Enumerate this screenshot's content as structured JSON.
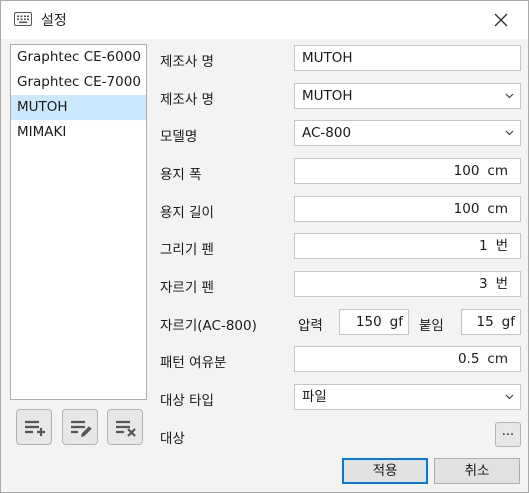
{
  "window": {
    "title": "설정"
  },
  "list": {
    "items": [
      "Graphtec CE-6000",
      "Graphtec CE-7000",
      "MUTOH",
      "MIMAKI"
    ],
    "selected_index": 2
  },
  "form": {
    "manufacturer_name_label": "제조사 명",
    "manufacturer_name_value": "MUTOH",
    "manufacturer_select_label": "제조사 명",
    "manufacturer_select_value": "MUTOH",
    "model_label": "모델명",
    "model_value": "AC-800",
    "paper_width_label": "용지 폭",
    "paper_width_value": "100",
    "paper_width_unit": "cm",
    "paper_length_label": "용지 길이",
    "paper_length_value": "100",
    "paper_length_unit": "cm",
    "draw_pen_label": "그리기 펜",
    "draw_pen_value": "1",
    "draw_pen_unit": "번",
    "cut_pen_label": "자르기 펜",
    "cut_pen_value": "3",
    "cut_pen_unit": "번",
    "cut_settings_label": "자르기(AC-800)",
    "pressure_label": "압력",
    "pressure_value": "150",
    "pressure_unit": "gf",
    "attach_label": "붙임",
    "attach_value": "15",
    "attach_unit": "gf",
    "pattern_margin_label": "패턴 여유분",
    "pattern_margin_value": "0.5",
    "pattern_margin_unit": "cm",
    "target_type_label": "대상 타입",
    "target_type_value": "파일",
    "target_label": "대상",
    "browse_label": "..."
  },
  "buttons": {
    "apply": "적용",
    "cancel": "취소"
  },
  "icons": {
    "title": "keyboard-icon",
    "close": "close-icon",
    "add": "list-add-icon",
    "edit": "list-edit-icon",
    "remove": "list-remove-icon",
    "dropdown": "chevron-down-icon"
  },
  "colors": {
    "selection": "#cce8ff",
    "accent": "#0078d7",
    "icon": "#555555"
  }
}
